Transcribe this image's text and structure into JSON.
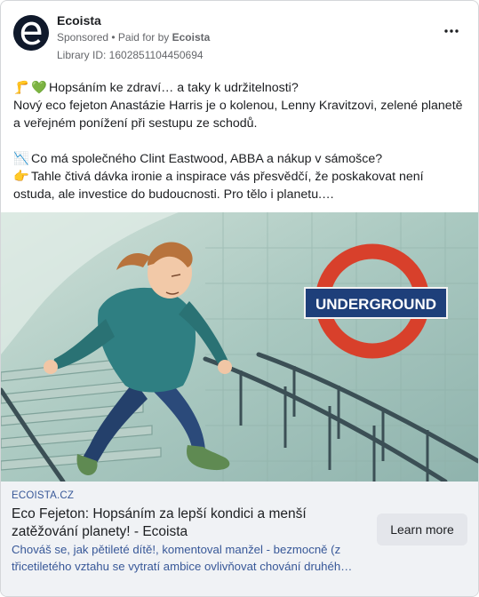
{
  "ad": {
    "page_name": "Ecoista",
    "sponsored": "Sponsored",
    "paid_prefix": " • Paid for by ",
    "paid_by": "Ecoista",
    "library_id": "Library ID: 1602851104450694"
  },
  "body": {
    "line1_emoji_a": "🦵",
    "line1_emoji_b": "💚",
    "line1": "Hopsáním ke zdraví… a taky k udržitelnosti?",
    "line2": "Nový eco fejeton Anastázie Harris je o kolenou, Lenny Kravitzovi, zelené planetě a veřejném ponížení při sestupu ze schodů.",
    "line3_emoji": "📉",
    "line3": "Co má společného Clint Eastwood, ABBA a nákup v sámošce?",
    "line4_emoji": "👉",
    "line4": "Tahle čtivá dávka ironie a inspirace vás přesvědčí, že poskakovat není ostuda, ale investice do budoucnosti. Pro tělo i planetu.…"
  },
  "image": {
    "sign_text": "UNDERGROUND"
  },
  "link": {
    "domain": "ECOISTA.CZ",
    "title": "Eco Fejeton: Hopsáním za lepší kondici a menší zatěžování planety! - Ecoista",
    "description": "Chováš se, jak pětileté dítě!, komentoval manžel - bezmocně (z třicetiletého vztahu se vytratí ambice ovlivňovat chování druhéh…",
    "cta": "Learn more"
  }
}
